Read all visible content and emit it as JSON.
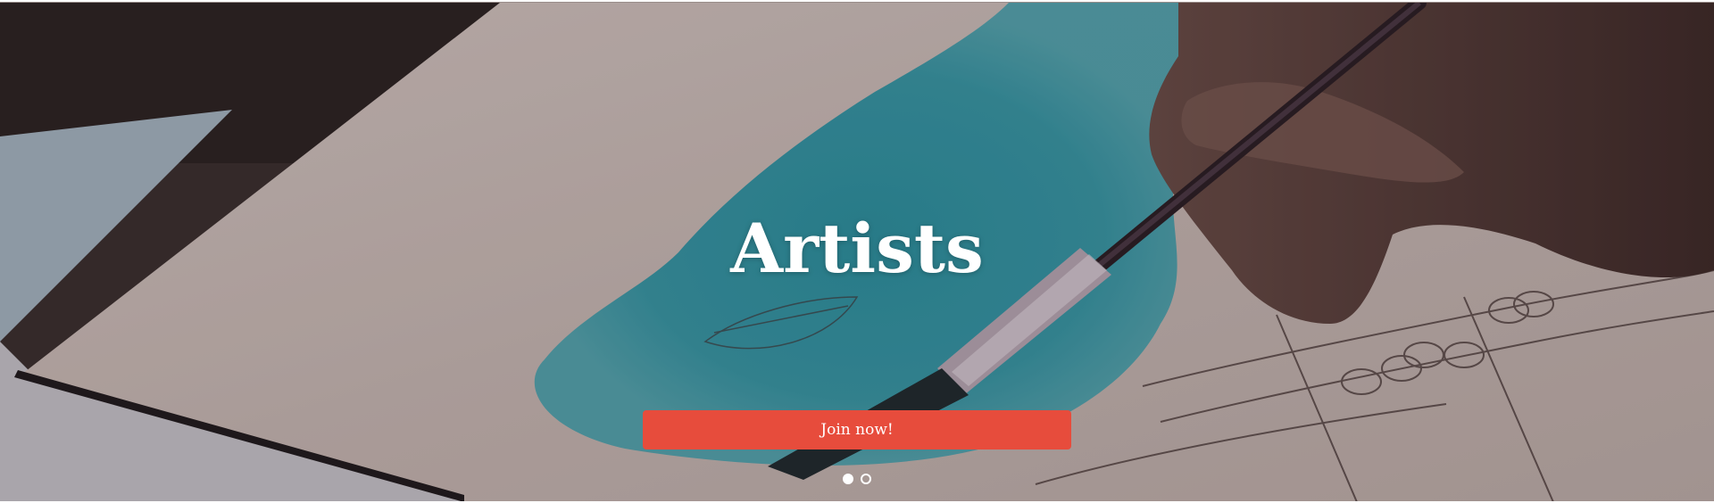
{
  "hero": {
    "title": "Artists",
    "cta_label": "Join now!",
    "background_image": "watercolor-painting-photo",
    "slides": {
      "total": 2,
      "active_index": 1
    }
  },
  "colors": {
    "cta_background": "#e74c3c",
    "title_text": "#ffffff"
  }
}
